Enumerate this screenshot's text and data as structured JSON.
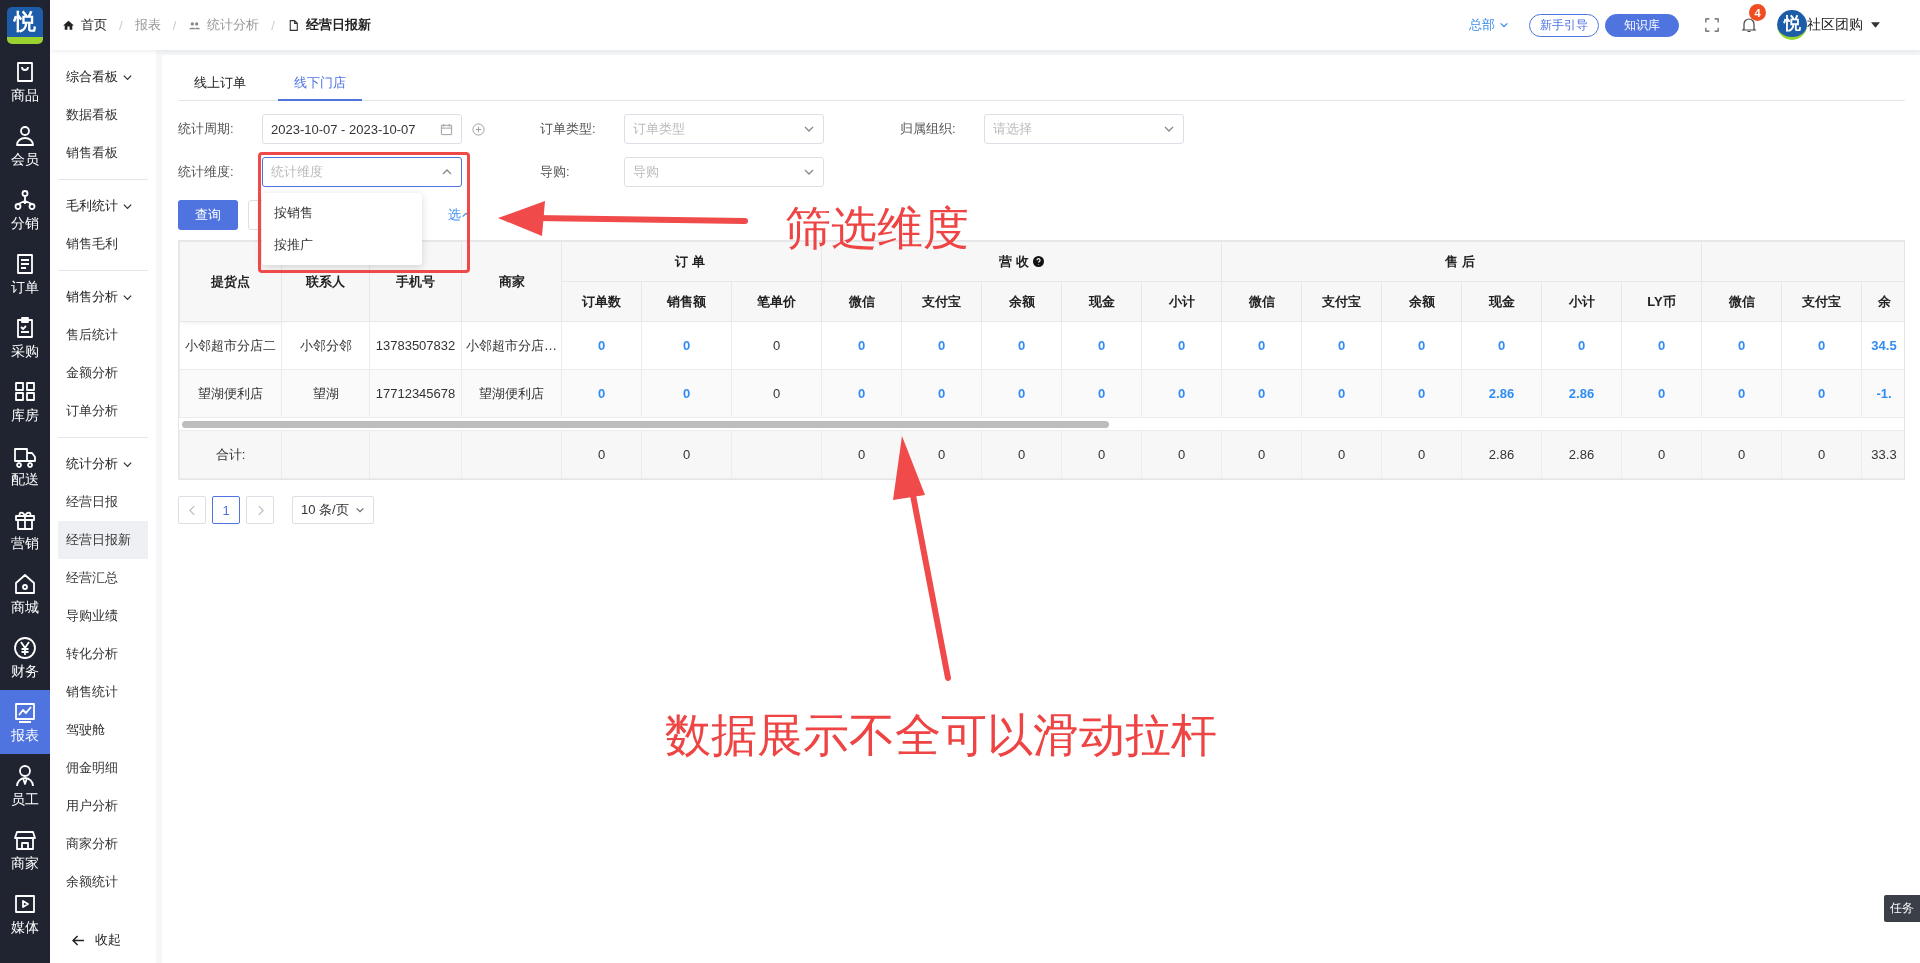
{
  "logo": {
    "text": "悦"
  },
  "rail": [
    {
      "label": "商品",
      "selected": false
    },
    {
      "label": "会员",
      "selected": false
    },
    {
      "label": "分销",
      "selected": false
    },
    {
      "label": "订单",
      "selected": false
    },
    {
      "label": "采购",
      "selected": false
    },
    {
      "label": "库房",
      "selected": false
    },
    {
      "label": "配送",
      "selected": false
    },
    {
      "label": "营销",
      "selected": false
    },
    {
      "label": "商城",
      "selected": false
    },
    {
      "label": "财务",
      "selected": false
    },
    {
      "label": "报表",
      "selected": true
    },
    {
      "label": "员工",
      "selected": false
    },
    {
      "label": "商家",
      "selected": false
    },
    {
      "label": "媒体",
      "selected": false
    }
  ],
  "breadcrumb": [
    "首页",
    "报表",
    "统计分析",
    "经营日报新"
  ],
  "breadcrumb_separator": "/",
  "header": {
    "org": "总部",
    "guide_button": "新手引导",
    "kb_button": "知识库",
    "notifications": "4",
    "avatar": "悦",
    "user": "社区团购"
  },
  "sidebar": {
    "groups": [
      {
        "label": "综合看板",
        "expanded": true,
        "children": [
          {
            "label": "数据看板",
            "selected": false
          },
          {
            "label": "销售看板",
            "selected": false
          }
        ]
      },
      {
        "label": "毛利统计",
        "expanded": true,
        "children": [
          {
            "label": "销售毛利",
            "selected": false
          }
        ]
      },
      {
        "label": "销售分析",
        "expanded": true,
        "children": [
          {
            "label": "售后统计",
            "selected": false
          },
          {
            "label": "金额分析",
            "selected": false
          },
          {
            "label": "订单分析",
            "selected": false
          }
        ]
      },
      {
        "label": "统计分析",
        "expanded": true,
        "children": [
          {
            "label": "经营日报",
            "selected": false
          },
          {
            "label": "经营日报新",
            "selected": true
          },
          {
            "label": "经营汇总",
            "selected": false
          },
          {
            "label": "导购业绩",
            "selected": false
          },
          {
            "label": "转化分析",
            "selected": false
          },
          {
            "label": "销售统计",
            "selected": false
          },
          {
            "label": "驾驶舱",
            "selected": false
          },
          {
            "label": "佣金明细",
            "selected": false
          },
          {
            "label": "用户分析",
            "selected": false
          },
          {
            "label": "商家分析",
            "selected": false
          },
          {
            "label": "余额统计",
            "selected": false
          }
        ]
      }
    ],
    "collapse": "收起"
  },
  "tabs": [
    {
      "label": "线上订单",
      "selected": false
    },
    {
      "label": "线下门店",
      "selected": true
    }
  ],
  "filters": [
    {
      "label": "统计周期:",
      "kind": "date",
      "value": "2023-10-07 - 2023-10-07"
    },
    {
      "label": "订单类型:",
      "kind": "select",
      "placeholder": "订单类型"
    },
    {
      "label": "归属组织:",
      "kind": "select",
      "placeholder": "请选择"
    },
    {
      "label": "统计维度:",
      "kind": "select",
      "placeholder": "统计维度",
      "expanded": true,
      "options": [
        "按销售",
        "按推广"
      ]
    },
    {
      "label": "导购:",
      "kind": "select",
      "placeholder": "导购"
    }
  ],
  "query_button": "查询",
  "toggle_link": "选",
  "table": {
    "fixed_columns": [
      "提货点",
      "联系人",
      "手机号",
      "商家"
    ],
    "groups": [
      {
        "label": "订单",
        "help": false,
        "columns": [
          {
            "label": "订单数",
            "link": true
          },
          {
            "label": "销售额",
            "link": true
          },
          {
            "label": "笔单价",
            "link": false
          }
        ]
      },
      {
        "label": "营收",
        "help": true,
        "columns": [
          {
            "label": "微信",
            "link": true
          },
          {
            "label": "支付宝",
            "link": true
          },
          {
            "label": "余额",
            "link": true
          },
          {
            "label": "现金",
            "link": true
          },
          {
            "label": "小计",
            "link": true
          }
        ]
      },
      {
        "label": "售后",
        "help": false,
        "columns": [
          {
            "label": "微信",
            "link": true
          },
          {
            "label": "支付宝",
            "link": true
          },
          {
            "label": "余额",
            "link": true
          },
          {
            "label": "现金",
            "link": true
          },
          {
            "label": "小计",
            "link": true
          },
          {
            "label": "LY币",
            "link": true
          }
        ]
      },
      {
        "columns": [
          {
            "label": "微信",
            "link": true
          },
          {
            "label": "支付宝",
            "link": true
          },
          {
            "label": "余",
            "link": true
          }
        ]
      }
    ],
    "rows": [
      {
        "cells": [
          "小邻超市分店二",
          "小邻分邻",
          "13783507832",
          "小邻超市分店…",
          "0",
          "0",
          "0",
          "0",
          "0",
          "0",
          "0",
          "0",
          "0",
          "0",
          "0",
          "0",
          "0",
          "0",
          "0",
          "0",
          "34.5"
        ]
      },
      {
        "cells": [
          "望湖便利店",
          "望湖",
          "17712345678",
          "望湖便利店",
          "0",
          "0",
          "0",
          "0",
          "0",
          "0",
          "0",
          "0",
          "0",
          "0",
          "0",
          "2.86",
          "2.86",
          "0",
          "0",
          "0",
          "-1."
        ]
      }
    ],
    "totals": {
      "label": "合计:",
      "cells": [
        null,
        null,
        null,
        "0",
        "0",
        null,
        "0",
        "0",
        "0",
        "0",
        "0",
        "0",
        "0",
        "0",
        "2.86",
        "2.86",
        "0",
        "0",
        "0",
        "33.3"
      ]
    }
  },
  "pagination": {
    "pages": [
      {
        "label": "1",
        "selected": true
      }
    ],
    "page_size": "10 条/页"
  },
  "task_badge": "任务",
  "annotations": [
    {
      "text": "筛选维度"
    },
    {
      "text": "数据展示不全可以滑动拉杆"
    }
  ]
}
